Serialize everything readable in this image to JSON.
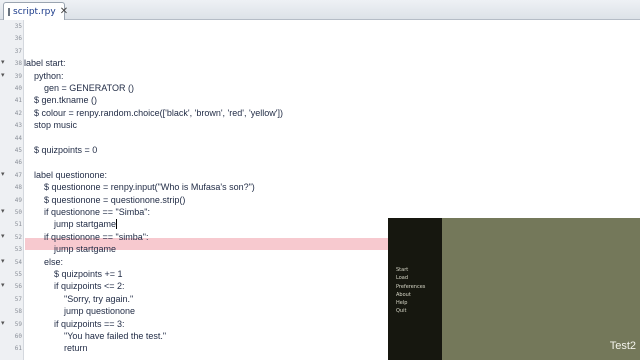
{
  "tab": {
    "label": "script.rpy",
    "close_glyph": "✕"
  },
  "editor": {
    "lines": [
      {
        "n": "35",
        "text": "",
        "indent": 0,
        "fold": false
      },
      {
        "n": "36",
        "text": "",
        "indent": 0,
        "fold": false
      },
      {
        "n": "37",
        "text": "",
        "indent": 0,
        "fold": false
      },
      {
        "n": "38",
        "text": "label start:",
        "indent": 0,
        "fold": true
      },
      {
        "n": "39",
        "text": "python:",
        "indent": 1,
        "fold": true
      },
      {
        "n": "40",
        "text": "gen = GENERATOR ()",
        "indent": 2,
        "fold": false
      },
      {
        "n": "41",
        "text": "$ gen.tkname ()",
        "indent": 1,
        "fold": false
      },
      {
        "n": "42",
        "text": "$ colour = renpy.random.choice(['black', 'brown', 'red', 'yellow'])",
        "indent": 1,
        "fold": false
      },
      {
        "n": "43",
        "text": "stop music",
        "indent": 1,
        "fold": false
      },
      {
        "n": "44",
        "text": "",
        "indent": 0,
        "fold": false
      },
      {
        "n": "45",
        "text": "$ quizpoints = 0",
        "indent": 1,
        "fold": false
      },
      {
        "n": "46",
        "text": "",
        "indent": 0,
        "fold": false
      },
      {
        "n": "47",
        "text": "label questionone:",
        "indent": 1,
        "fold": true
      },
      {
        "n": "48",
        "text": "$ questionone = renpy.input(\"Who is Mufasa's son?\")",
        "indent": 2,
        "fold": false
      },
      {
        "n": "49",
        "text": "$ questionone = questionone.strip()",
        "indent": 2,
        "fold": false
      },
      {
        "n": "50",
        "text": "if questionone == \"Simba\":",
        "indent": 2,
        "fold": true
      },
      {
        "n": "51",
        "text": "jump startgame",
        "indent": 3,
        "fold": false
      },
      {
        "n": "52",
        "text": "if questionone == \"simba\":",
        "indent": 2,
        "fold": true
      },
      {
        "n": "53",
        "text": "jump startgame",
        "indent": 3,
        "fold": false
      },
      {
        "n": "54",
        "text": "else:",
        "indent": 2,
        "fold": true
      },
      {
        "n": "55",
        "text": "$ quizpoints += 1",
        "indent": 3,
        "fold": false
      },
      {
        "n": "56",
        "text": "if quizpoints <= 2:",
        "indent": 3,
        "fold": true
      },
      {
        "n": "57",
        "text": "\"Sorry, try again.\"",
        "indent": 4,
        "fold": false
      },
      {
        "n": "58",
        "text": "jump questionone",
        "indent": 4,
        "fold": false
      },
      {
        "n": "59",
        "text": "if quizpoints == 3:",
        "indent": 3,
        "fold": true
      },
      {
        "n": "60",
        "text": "\"You have failed the test.\"",
        "indent": 4,
        "fold": false
      },
      {
        "n": "61",
        "text": "return",
        "indent": 4,
        "fold": false
      }
    ],
    "current_line": "51"
  },
  "game": {
    "menu": [
      "Start",
      "Load",
      "Preferences",
      "About",
      "Help",
      "Quit"
    ],
    "title": "Test2"
  },
  "colors": {
    "current_line_highlight": "#f7c9cf",
    "game_background": "#74785a",
    "game_menu_panel": "#16170f"
  }
}
